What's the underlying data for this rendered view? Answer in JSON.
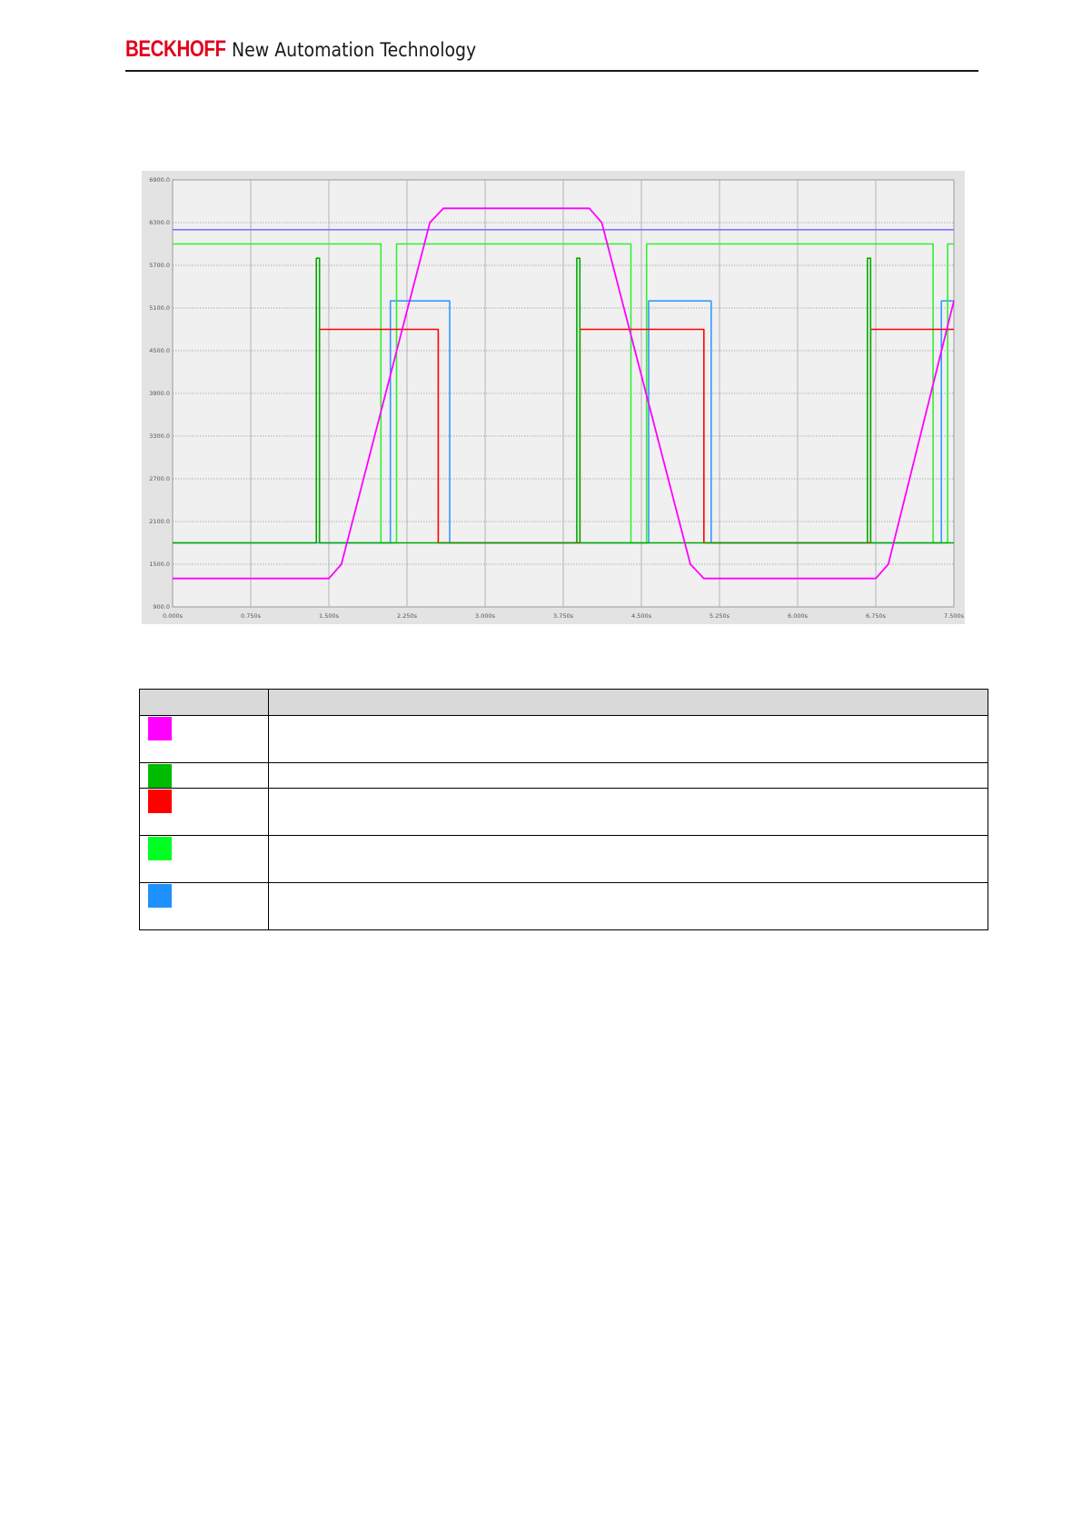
{
  "header": {
    "brand": "BECKHOFF",
    "tagline": "New Automation Technology"
  },
  "chart_data": {
    "type": "line",
    "title": "",
    "xlabel": "",
    "ylabel": "",
    "x_ticks": [
      "0.000s",
      "0.750s",
      "1.500s",
      "2.250s",
      "3.000s",
      "3.750s",
      "4.500s",
      "5.250s",
      "6.000s",
      "6.750s",
      "7.500s"
    ],
    "y_ticks": [
      "900.0",
      "1500.0",
      "2100.0",
      "2700.0",
      "3300.0",
      "3900.0",
      "4500.0",
      "5100.0",
      "5700.0",
      "6300.0",
      "6900.0"
    ],
    "xlim": [
      0,
      7.5
    ],
    "ylim": [
      900,
      6900
    ],
    "grid": true,
    "series": [
      {
        "color": "#ff00ff",
        "x": [
          0,
          1.5,
          1.62,
          2.47,
          2.6,
          4.0,
          4.12,
          4.97,
          5.1,
          6.75,
          6.87,
          7.5
        ],
        "y": [
          1300,
          1300,
          1500,
          6300,
          6500,
          6500,
          6300,
          1500,
          1300,
          1300,
          1500,
          5200
        ]
      },
      {
        "color": "#00aa00",
        "x": [
          0,
          1.38,
          1.38,
          1.41,
          1.41,
          2.5,
          2.5,
          3.88,
          3.88,
          3.91,
          3.91,
          6.67,
          6.67,
          6.7,
          6.7,
          7.5
        ],
        "y": [
          1800,
          1800,
          5800,
          5800,
          1800,
          1800,
          1800,
          1800,
          5800,
          5800,
          1800,
          1800,
          5800,
          5800,
          1800,
          1800
        ]
      },
      {
        "color": "#ff0000",
        "x": [
          1.41,
          1.41,
          2.55,
          2.55,
          3.91,
          3.91,
          5.1,
          5.1,
          6.7,
          6.7,
          7.5
        ],
        "y": [
          1800,
          4800,
          4800,
          1800,
          1800,
          4800,
          4800,
          1800,
          1800,
          4800,
          4800
        ]
      },
      {
        "color": "#33ee33",
        "x": [
          0,
          2.0,
          2.0,
          2.15,
          2.15,
          4.4,
          4.4,
          4.55,
          4.55,
          7.3,
          7.3,
          7.44,
          7.44,
          7.5
        ],
        "y": [
          6000,
          6000,
          1800,
          1800,
          6000,
          6000,
          1800,
          1800,
          6000,
          6000,
          1800,
          1800,
          6000,
          6000
        ]
      },
      {
        "color": "#3399ff",
        "x": [
          0,
          2.09,
          2.09,
          2.66,
          2.66,
          4.57,
          4.57,
          5.17,
          5.17,
          7.38,
          7.38,
          7.5
        ],
        "y": [
          1800,
          1800,
          5200,
          5200,
          1800,
          1800,
          5200,
          5200,
          1800,
          1800,
          5200,
          5200
        ]
      },
      {
        "color": "#7777ff",
        "x": [
          0,
          7.5
        ],
        "y": [
          6200,
          6200
        ]
      }
    ]
  },
  "legend_table": {
    "header": [
      "",
      ""
    ],
    "rows": [
      {
        "color": "#ff00ff",
        "description": ""
      },
      {
        "color": "#00bb00",
        "description": ""
      },
      {
        "color": "#ff0000",
        "description": ""
      },
      {
        "color": "#00ff22",
        "description": ""
      },
      {
        "color": "#1e90ff",
        "description": ""
      }
    ]
  }
}
